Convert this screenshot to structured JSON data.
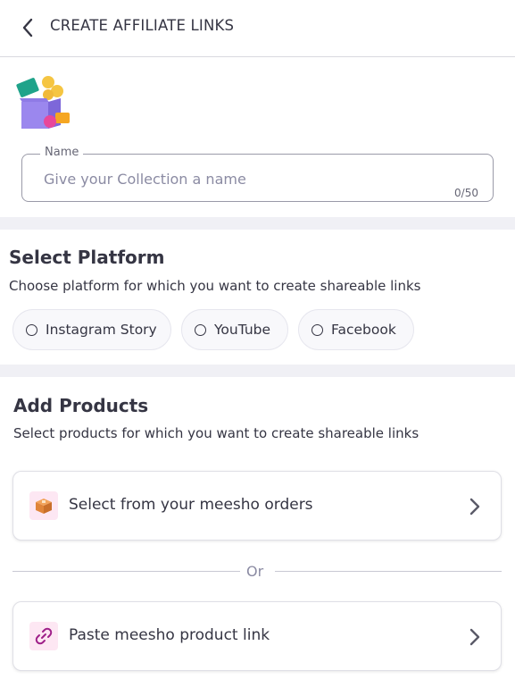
{
  "header": {
    "title": "CREATE AFFILIATE LINKS"
  },
  "name_field": {
    "label": "Name",
    "placeholder": "Give your Collection a name",
    "value": "",
    "counter": "0/50"
  },
  "platform": {
    "title": "Select Platform",
    "subtitle": "Choose platform for which you want to create shareable links",
    "options": [
      {
        "label": "Instagram Story",
        "selected": false
      },
      {
        "label": "YouTube",
        "selected": false
      },
      {
        "label": "Facebook",
        "selected": false
      }
    ]
  },
  "products": {
    "title": "Add Products",
    "subtitle": "Select products for which you want to create shareable links",
    "options": [
      {
        "label": "Select from your meesho orders",
        "icon": "package-icon"
      },
      {
        "label": "Paste meesho product link",
        "icon": "link-icon"
      }
    ],
    "divider_text": "Or"
  },
  "colors": {
    "text": "#353543",
    "accent_pink": "#9f2089",
    "chip_bg": "#f8f8fb",
    "band_bg": "#f0f0f5"
  }
}
